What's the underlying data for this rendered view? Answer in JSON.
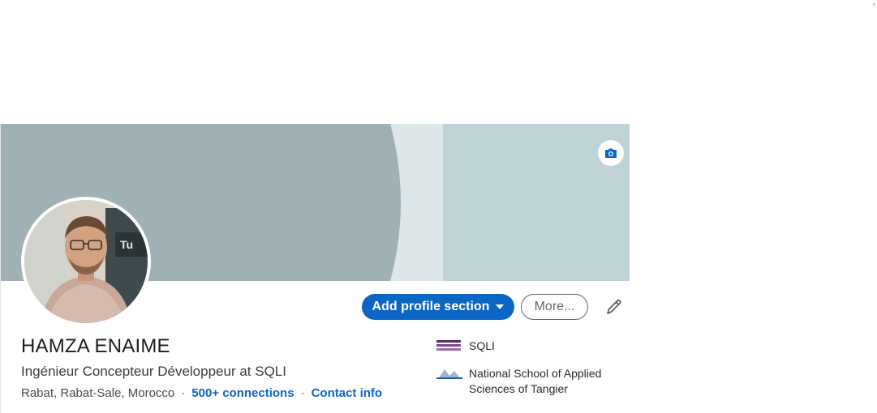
{
  "profile": {
    "name": "HAMZA ENAIME",
    "headline": "Ingénieur Concepteur Développeur at SQLI",
    "location": "Rabat, Rabat-Sale, Morocco",
    "separator": "·",
    "connections": "500+ connections",
    "contact_info": "Contact info"
  },
  "actions": {
    "add_section_label": "Add profile section",
    "more_label": "More..."
  },
  "organizations": [
    {
      "name": "SQLI",
      "logo_icon": "sqli-logo"
    },
    {
      "name_line1": "National School of Applied",
      "name_line2": "Sciences of Tangier",
      "logo_icon": "ensa-logo"
    }
  ],
  "icons": {
    "camera": "camera-icon",
    "edit": "pencil-icon",
    "dropdown": "caret-down-icon"
  },
  "colors": {
    "accent": "#0a66c2",
    "banner_dark": "#9fb1b5",
    "banner_light": "#dde7e9",
    "banner_right": "#bfd2d6"
  }
}
